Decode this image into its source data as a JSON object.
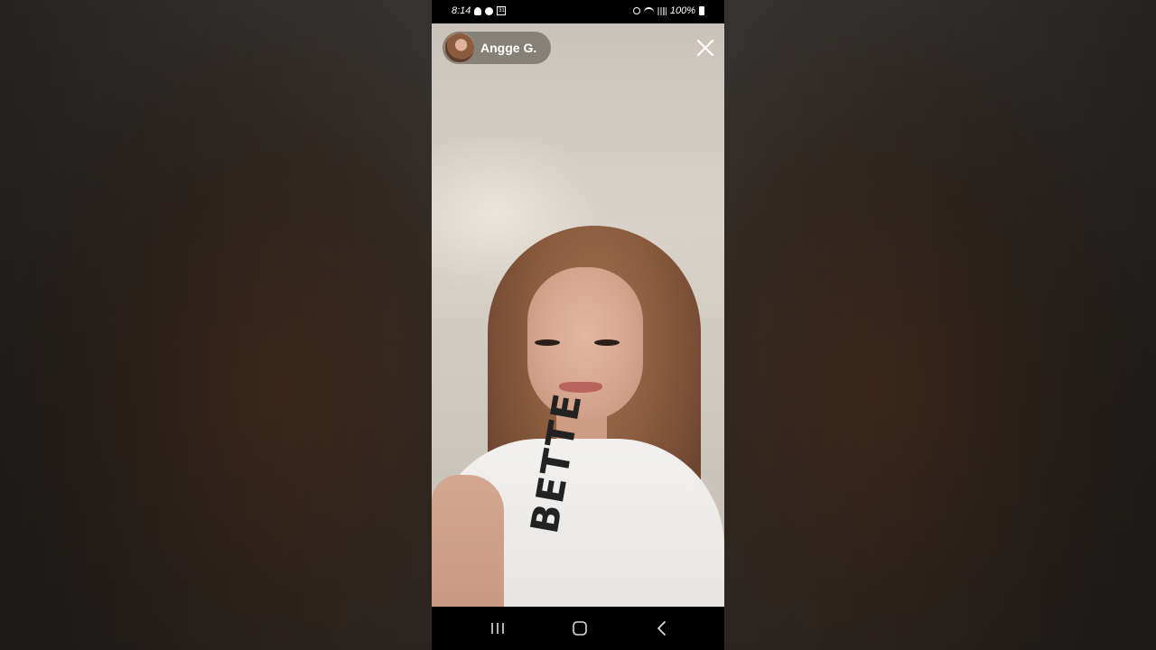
{
  "status_bar": {
    "time": "8:14",
    "calendar_day": "31",
    "battery": "100%"
  },
  "story": {
    "user_name": "Angge G.",
    "shirt_text": "BETTE"
  },
  "colors": {
    "status_bar_bg": "#000000",
    "nav_bar_bg": "#000000",
    "chip_bg": "#6e6962",
    "icon_color": "#ffffff"
  },
  "icons": {
    "close": "close-icon",
    "recents": "recents-icon",
    "home": "home-icon",
    "back": "back-icon"
  }
}
